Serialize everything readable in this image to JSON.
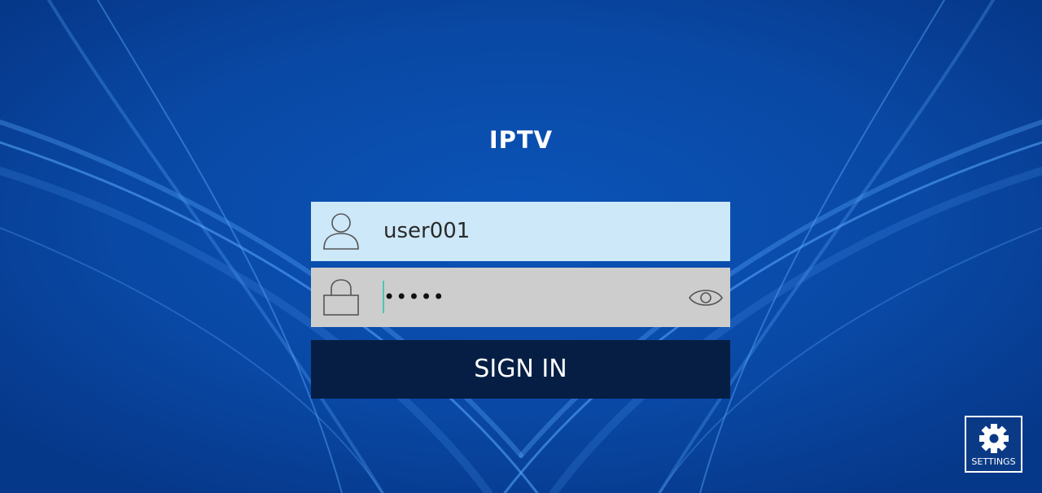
{
  "app": {
    "title": "IPTV"
  },
  "login": {
    "username_value": "user001",
    "password_masked": "•••••",
    "signin_label": "SIGN IN"
  },
  "settings": {
    "label": "SETTINGS"
  },
  "colors": {
    "background": "#0a4aa8",
    "username_field": "#cde8f8",
    "password_field": "#cdcdcd",
    "signin_button": "#061e44",
    "caret": "#4fc6b3"
  },
  "icons": {
    "username": "user-icon",
    "password": "lock-icon",
    "reveal": "eye-icon",
    "settings": "gear-icon"
  }
}
